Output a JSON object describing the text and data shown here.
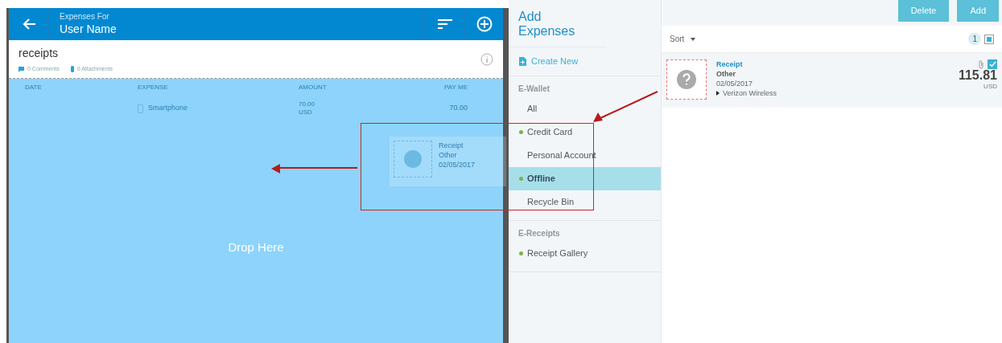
{
  "header": {
    "subtitle": "Expenses For",
    "title": "User Name"
  },
  "report": {
    "name": "receipts",
    "comments": "0 Comments",
    "attachments": "0 Attachments"
  },
  "table": {
    "columns": [
      "DATE",
      "EXPENSE",
      "AMOUNT",
      "PAY ME"
    ],
    "rows": [
      {
        "expense": "Smartphone",
        "amount": "70.00",
        "currency": "USD",
        "pay_me": "70.00"
      }
    ]
  },
  "drop_zone": {
    "label": "Drop Here"
  },
  "drag_ghost": {
    "title": "Receipt",
    "category": "Other",
    "date": "02/05/2017"
  },
  "sidebar": {
    "title": "Add Expenses",
    "create": "Create New",
    "sections": [
      {
        "heading": "E-Wallet",
        "items": [
          {
            "label": "All",
            "dot": false,
            "selected": false
          },
          {
            "label": "Credit Card",
            "dot": true,
            "selected": false
          },
          {
            "label": "Personal Account",
            "dot": false,
            "selected": false
          },
          {
            "label": "Offline",
            "dot": true,
            "selected": true
          },
          {
            "label": "Recycle Bin",
            "dot": false,
            "selected": false
          }
        ]
      },
      {
        "heading": "E-Receipts",
        "items": [
          {
            "label": "Receipt Gallery",
            "dot": true,
            "selected": false
          }
        ]
      }
    ]
  },
  "toolbar": {
    "buttons": [
      "Delete",
      "Add"
    ]
  },
  "list": {
    "sort": "Sort",
    "count": "1",
    "items": [
      {
        "title": "Receipt",
        "category": "Other",
        "date": "02/05/2017",
        "merchant": "Verizon Wireless",
        "amount": "115.81",
        "currency": "USD",
        "checked": true,
        "has_attachment": true
      }
    ]
  }
}
